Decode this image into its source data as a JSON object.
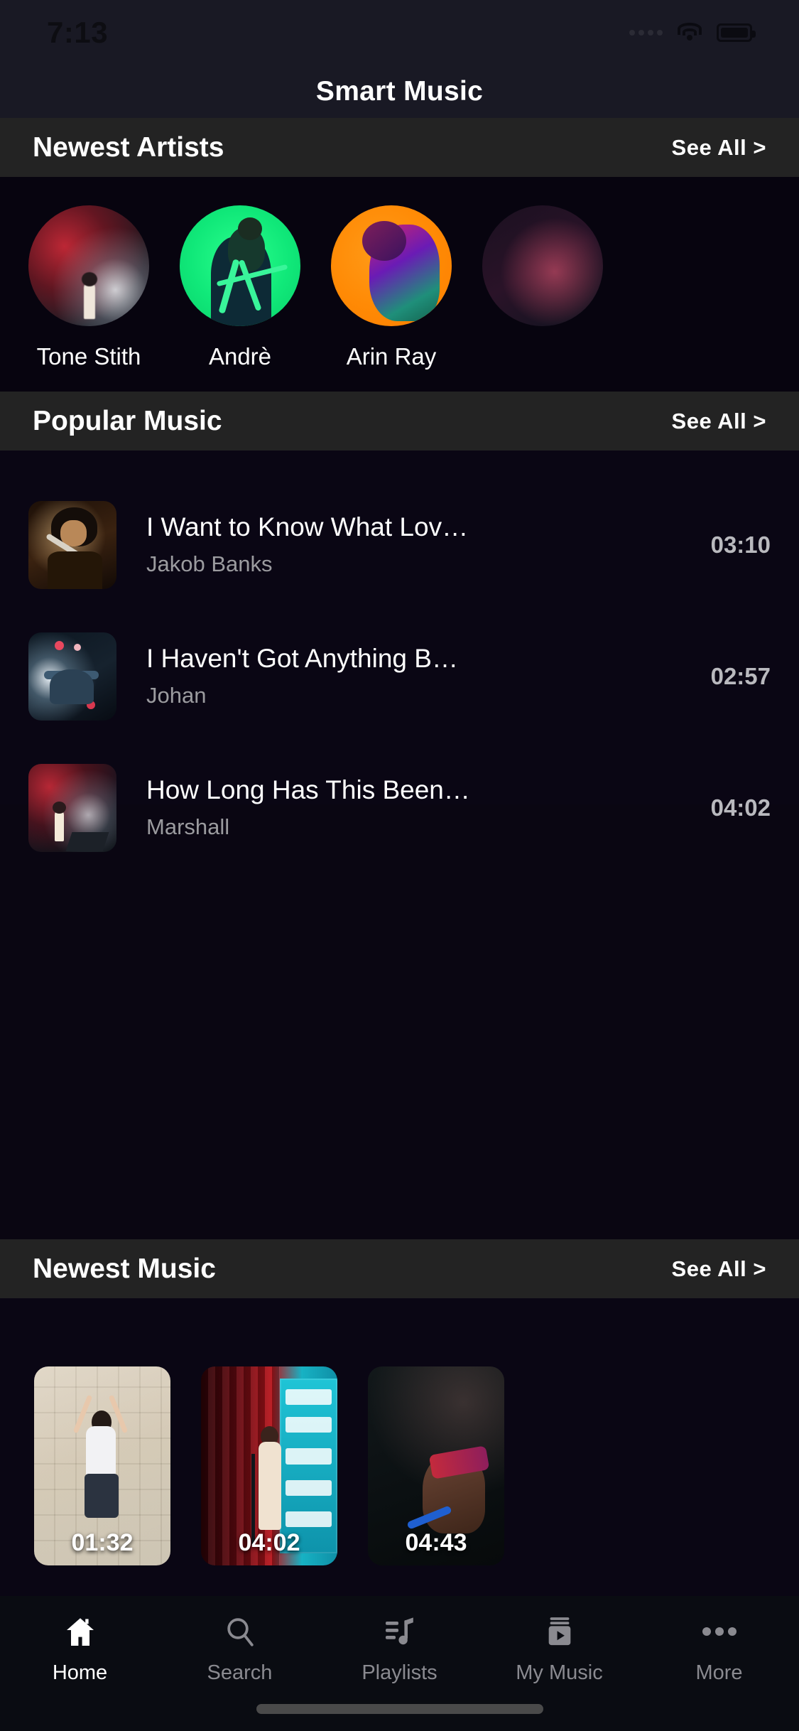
{
  "status_bar": {
    "time": "7:13",
    "signal_icon": "signal-dots-icon",
    "wifi_icon": "wifi-icon",
    "battery_icon": "battery-icon"
  },
  "app": {
    "title": "Smart Music",
    "background": "#0a0614",
    "header_background": "#191924",
    "section_background": "#232323",
    "accent_text": "#ffffff",
    "muted_text": "#9b9b9f"
  },
  "sections": {
    "artists": {
      "title": "Newest Artists",
      "see_all": "See All >"
    },
    "popular": {
      "title": "Popular Music",
      "see_all": "See All >"
    },
    "newest": {
      "title": "Newest Music",
      "see_all": "See All >"
    }
  },
  "artists": [
    {
      "name": "Tone Stith"
    },
    {
      "name": "Andrè"
    },
    {
      "name": "Arin Ray"
    },
    {
      "name": ""
    }
  ],
  "popular_music": [
    {
      "title": "I Want to Know What Lov…",
      "artist": "Jakob Banks",
      "duration": "03:10"
    },
    {
      "title": "I Haven't Got Anything B…",
      "artist": "Johan",
      "duration": "02:57"
    },
    {
      "title": "How Long Has This Been…",
      "artist": "Marshall",
      "duration": "04:02"
    }
  ],
  "newest_music": [
    {
      "duration": "01:32"
    },
    {
      "duration": "04:02"
    },
    {
      "duration": "04:43"
    }
  ],
  "bottom_nav": [
    {
      "label": "Home",
      "icon": "home-icon",
      "active": true
    },
    {
      "label": "Search",
      "icon": "search-icon",
      "active": false
    },
    {
      "label": "Playlists",
      "icon": "playlist-icon",
      "active": false
    },
    {
      "label": "My Music",
      "icon": "my-music-icon",
      "active": false
    },
    {
      "label": "More",
      "icon": "more-dots-icon",
      "active": false
    }
  ]
}
